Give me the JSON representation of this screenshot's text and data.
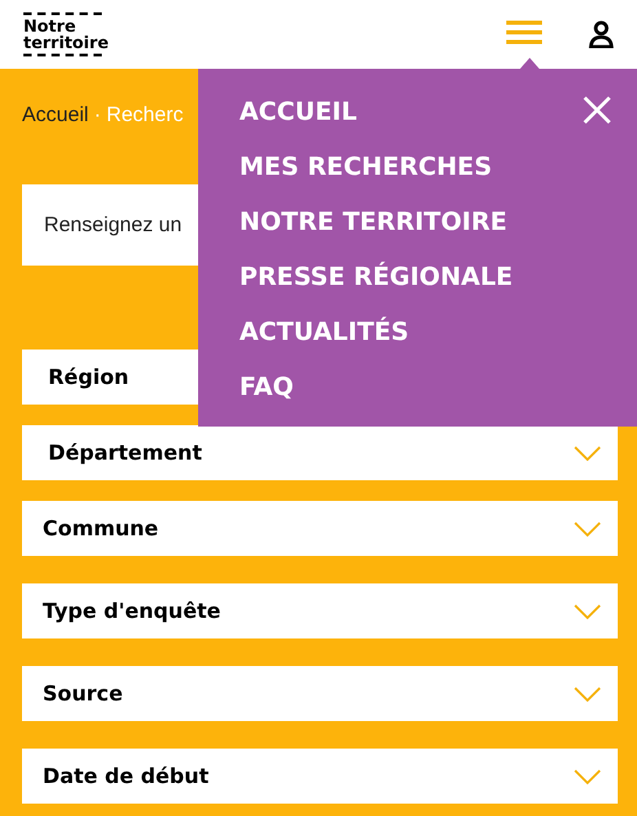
{
  "header": {
    "logo": [
      "Notre",
      "territoire"
    ]
  },
  "breadcrumb": {
    "home": "Accueil",
    "separator": "·",
    "current": "Recherc"
  },
  "search": {
    "placeholder": "Renseignez un"
  },
  "filters": [
    {
      "label": "Région"
    },
    {
      "label": "Département"
    },
    {
      "label": "Commune"
    },
    {
      "label": "Type d'enquête"
    },
    {
      "label": "Source"
    },
    {
      "label": "Date de début"
    }
  ],
  "menu": {
    "items": [
      "ACCUEIL",
      "MES RECHERCHES",
      "NOTRE TERRITOIRE",
      "PRESSE RÉGIONALE",
      "ACTUALITÉS",
      "FAQ"
    ]
  }
}
